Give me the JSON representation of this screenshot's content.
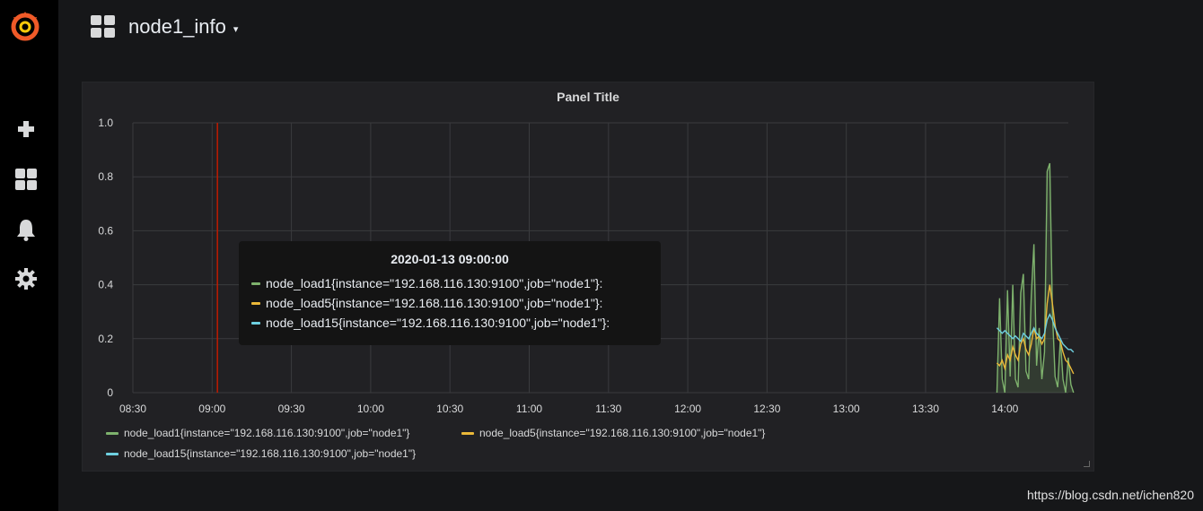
{
  "sidebar": {
    "items": [
      "logo-icon",
      "plus-icon",
      "dashboards-icon",
      "bell-icon",
      "gear-icon"
    ]
  },
  "dashboard": {
    "title": "node1_info",
    "caret": "▾"
  },
  "panel": {
    "title": "Panel Title",
    "tooltip": {
      "time": "2020-01-13 09:00:00",
      "rows": [
        "node_load1{instance=\"192.168.116.130:9100\",job=\"node1\"}:",
        "node_load5{instance=\"192.168.116.130:9100\",job=\"node1\"}:",
        "node_load15{instance=\"192.168.116.130:9100\",job=\"node1\"}:"
      ]
    }
  },
  "colors": {
    "load1": "#7eb26d",
    "load5": "#eab839",
    "load15": "#6ed0e0",
    "cursor": "#bf1b00"
  },
  "chart_data": {
    "type": "line",
    "title": "Panel Title",
    "ylim": [
      0,
      1.0
    ],
    "y_ticks": [
      "1.0",
      "0.8",
      "0.6",
      "0.4",
      "0.2",
      "0"
    ],
    "x_ticks": [
      "08:30",
      "09:00",
      "09:30",
      "10:00",
      "10:30",
      "11:00",
      "11:30",
      "12:00",
      "12:30",
      "13:00",
      "13:30",
      "14:00"
    ],
    "cursor_time": "09:02",
    "grid": true,
    "legend_position": "bottom",
    "series": [
      {
        "name": "node_load1{instance=\"192.168.116.130:9100\",job=\"node1\"}",
        "color": "#7eb26d",
        "fill": true,
        "points": [
          [
            "13:57",
            0.0
          ],
          [
            "13:58",
            0.35
          ],
          [
            "13:59",
            0.05
          ],
          [
            "14:00",
            0.0
          ],
          [
            "14:01",
            0.38
          ],
          [
            "14:02",
            0.06
          ],
          [
            "14:03",
            0.4
          ],
          [
            "14:04",
            0.05
          ],
          [
            "14:05",
            0.02
          ],
          [
            "14:06",
            0.37
          ],
          [
            "14:07",
            0.44
          ],
          [
            "14:08",
            0.08
          ],
          [
            "14:09",
            0.05
          ],
          [
            "14:10",
            0.36
          ],
          [
            "14:11",
            0.55
          ],
          [
            "14:12",
            0.1
          ],
          [
            "14:13",
            0.24
          ],
          [
            "14:14",
            0.05
          ],
          [
            "14:15",
            0.15
          ],
          [
            "14:16",
            0.82
          ],
          [
            "14:17",
            0.85
          ],
          [
            "14:18",
            0.3
          ],
          [
            "14:19",
            0.06
          ],
          [
            "14:20",
            0.02
          ],
          [
            "14:21",
            0.2
          ],
          [
            "14:22",
            0.05
          ],
          [
            "14:23",
            0.0
          ],
          [
            "14:24",
            0.13
          ],
          [
            "14:25",
            0.03
          ],
          [
            "14:26",
            0.0
          ]
        ]
      },
      {
        "name": "node_load5{instance=\"192.168.116.130:9100\",job=\"node1\"}",
        "color": "#eab839",
        "fill": false,
        "points": [
          [
            "13:57",
            0.11
          ],
          [
            "13:58",
            0.1
          ],
          [
            "13:59",
            0.12
          ],
          [
            "14:00",
            0.09
          ],
          [
            "14:01",
            0.14
          ],
          [
            "14:02",
            0.12
          ],
          [
            "14:03",
            0.17
          ],
          [
            "14:04",
            0.14
          ],
          [
            "14:05",
            0.12
          ],
          [
            "14:06",
            0.18
          ],
          [
            "14:07",
            0.2
          ],
          [
            "14:08",
            0.16
          ],
          [
            "14:09",
            0.14
          ],
          [
            "14:10",
            0.18
          ],
          [
            "14:11",
            0.24
          ],
          [
            "14:12",
            0.2
          ],
          [
            "14:13",
            0.21
          ],
          [
            "14:14",
            0.18
          ],
          [
            "14:15",
            0.2
          ],
          [
            "14:16",
            0.33
          ],
          [
            "14:17",
            0.4
          ],
          [
            "14:18",
            0.33
          ],
          [
            "14:19",
            0.25
          ],
          [
            "14:20",
            0.2
          ],
          [
            "14:21",
            0.19
          ],
          [
            "14:22",
            0.15
          ],
          [
            "14:23",
            0.12
          ],
          [
            "14:24",
            0.11
          ],
          [
            "14:25",
            0.09
          ],
          [
            "14:26",
            0.07
          ]
        ]
      },
      {
        "name": "node_load15{instance=\"192.168.116.130:9100\",job=\"node1\"}",
        "color": "#6ed0e0",
        "fill": false,
        "points": [
          [
            "13:57",
            0.24
          ],
          [
            "13:58",
            0.23
          ],
          [
            "13:59",
            0.22
          ],
          [
            "14:00",
            0.23
          ],
          [
            "14:01",
            0.22
          ],
          [
            "14:02",
            0.21
          ],
          [
            "14:03",
            0.2
          ],
          [
            "14:04",
            0.21
          ],
          [
            "14:05",
            0.2
          ],
          [
            "14:06",
            0.19
          ],
          [
            "14:07",
            0.22
          ],
          [
            "14:08",
            0.21
          ],
          [
            "14:09",
            0.2
          ],
          [
            "14:10",
            0.22
          ],
          [
            "14:11",
            0.24
          ],
          [
            "14:12",
            0.22
          ],
          [
            "14:13",
            0.21
          ],
          [
            "14:14",
            0.2
          ],
          [
            "14:15",
            0.22
          ],
          [
            "14:16",
            0.27
          ],
          [
            "14:17",
            0.29
          ],
          [
            "14:18",
            0.27
          ],
          [
            "14:19",
            0.24
          ],
          [
            "14:20",
            0.22
          ],
          [
            "14:21",
            0.2
          ],
          [
            "14:22",
            0.18
          ],
          [
            "14:23",
            0.17
          ],
          [
            "14:24",
            0.16
          ],
          [
            "14:25",
            0.16
          ],
          [
            "14:26",
            0.15
          ]
        ]
      }
    ]
  },
  "watermark": "https://blog.csdn.net/ichen820"
}
